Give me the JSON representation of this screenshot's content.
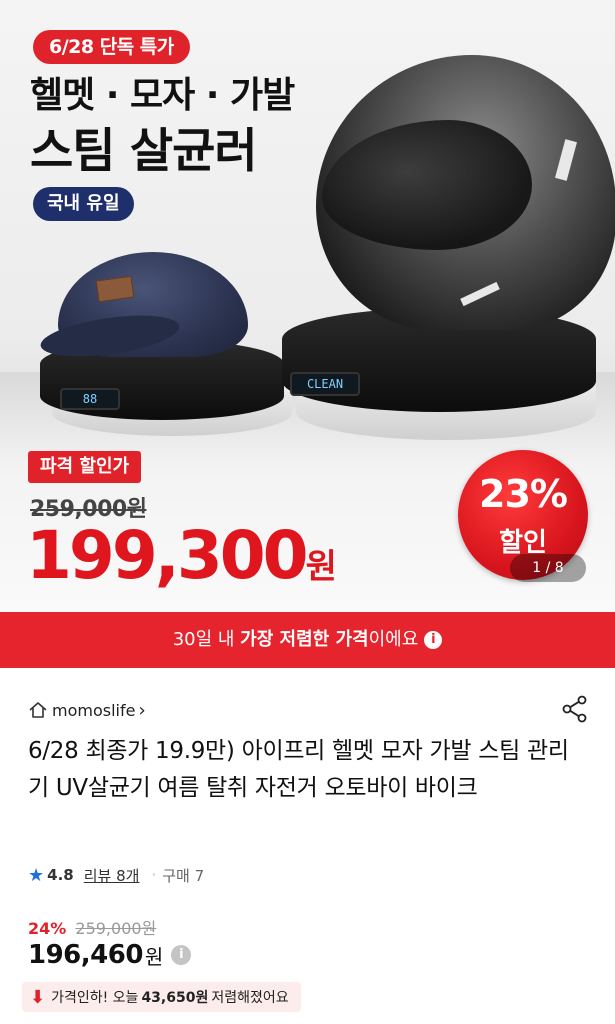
{
  "hero": {
    "promo_date": "6/28 단독 특가",
    "headline_line1": "헬멧 · 모자 · 가발",
    "headline_line2": "스팀 살균러",
    "only_badge": "국내 유일",
    "lcd_left": "88",
    "lcd_right": "CLEAN",
    "discount_pct": "23%",
    "discount_word": "할인",
    "sale_label": "파격 할인가",
    "original_price": "259,000원",
    "sale_price": "199,300",
    "sale_price_unit": "원",
    "page_indicator": "1 / 8"
  },
  "banner": {
    "prefix": "30일 내 ",
    "bold": "가장 저렴한 가격",
    "suffix": "이에요",
    "info_icon": "i"
  },
  "product": {
    "store_name": "momoslife",
    "store_chevron": "›",
    "title": "6/28 최종가 19.9만) 아이프리 헬멧 모자 가발 스팀 관리기 UV살균기 여름 탈취 자전거 오토바이 바이크",
    "rating": "4.8",
    "review_label": "리뷰 8개",
    "purchase_label": "구매 7",
    "discount_pct": "24%",
    "original_price": "259,000원",
    "final_price": "196,460",
    "final_unit": "원",
    "drop_prefix": "가격인하! 오늘",
    "drop_amount": "43,650원",
    "drop_suffix": "저렴해졌어요"
  },
  "icons": {
    "home": "home-icon",
    "share": "share-icon",
    "star": "star-icon",
    "info": "info-icon",
    "price_drop": "down-arrow-icon"
  },
  "colors": {
    "accent_red": "#e0232b",
    "navy": "#1f2f6b",
    "rating_blue": "#1e6fe0"
  }
}
